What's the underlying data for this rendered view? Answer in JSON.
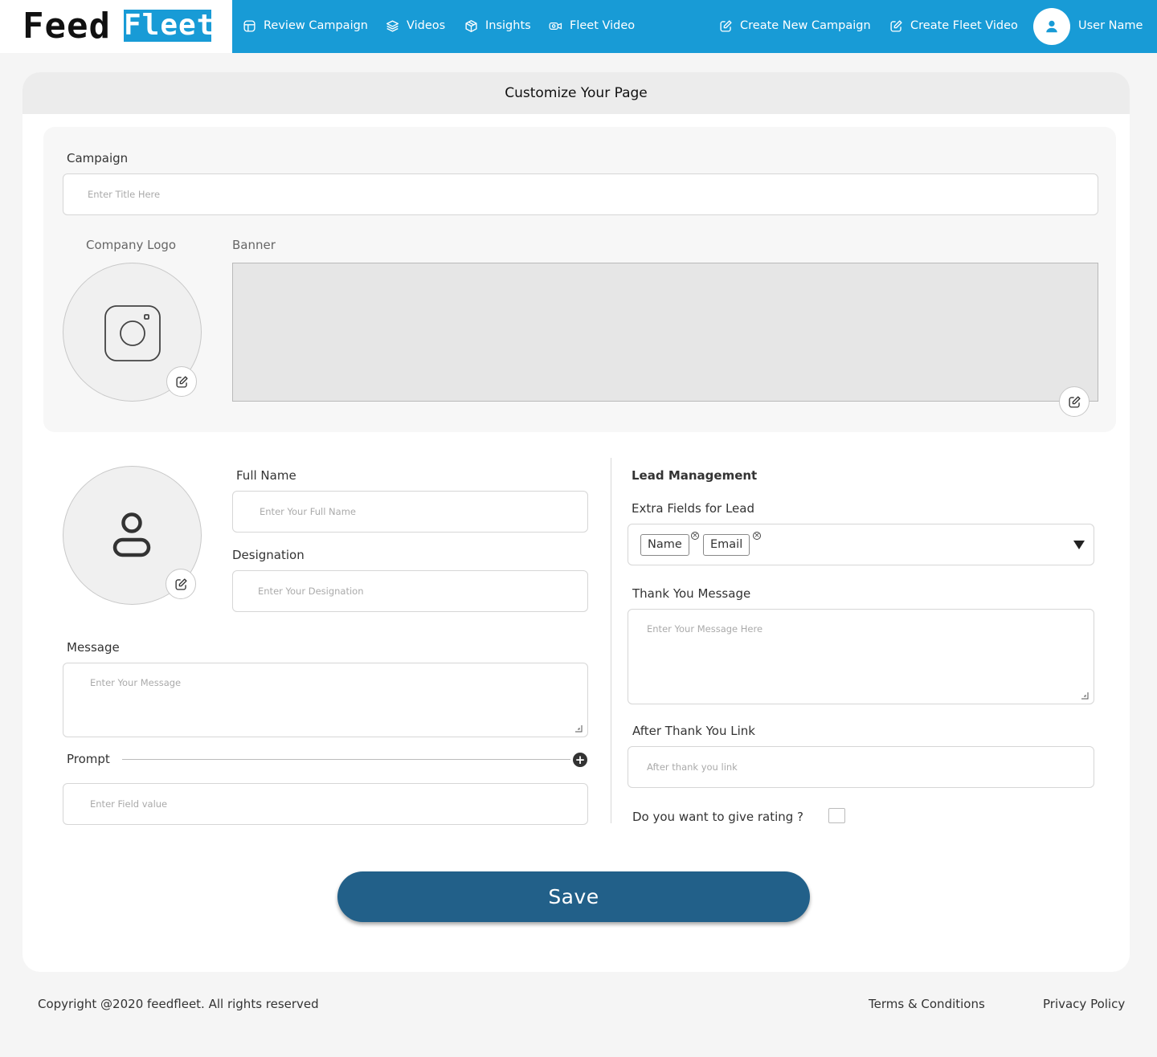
{
  "header": {
    "logo": {
      "part1": "Feed",
      "part2": "Fleet"
    },
    "nav": [
      {
        "label": "Review Campaign",
        "icon": "layout-icon"
      },
      {
        "label": "Videos",
        "icon": "layers-icon"
      },
      {
        "label": "Insights",
        "icon": "box-icon"
      },
      {
        "label": "Fleet Video",
        "icon": "video-camera-icon"
      }
    ],
    "actions": [
      {
        "label": "Create New Campaign",
        "icon": "edit-icon"
      },
      {
        "label": "Create Fleet Video",
        "icon": "edit-icon"
      }
    ],
    "user_name": "User Name",
    "accent_color": "#189bd6"
  },
  "page": {
    "title": "Customize Your Page",
    "campaign": {
      "label": "Campaign",
      "placeholder": "Enter Title Here"
    },
    "company_logo_label": "Company Logo",
    "banner_label": "Banner",
    "full_name": {
      "label": "Full Name",
      "placeholder": "Enter Your Full Name"
    },
    "designation": {
      "label": "Designation",
      "placeholder": "Enter Your Designation"
    },
    "message": {
      "label": "Message",
      "placeholder": "Enter Your Message"
    },
    "prompt": {
      "label": "Prompt",
      "placeholder": "Enter Field value",
      "add_symbol": "+"
    },
    "lead": {
      "heading": "Lead Management",
      "extra_fields_label": "Extra Fields for Lead",
      "extra_fields": [
        "Name",
        "Email"
      ],
      "remove_symbol": "×",
      "thank_you": {
        "label": "Thank You Message",
        "placeholder": "Enter Your Message Here"
      },
      "after_link": {
        "label": "After Thank You Link",
        "placeholder": "After thank you link"
      },
      "rating_label": "Do you want to give rating ?"
    },
    "save_label": "Save",
    "save_color": "#226089"
  },
  "footer": {
    "copyright": "Copyright @2020 feedfleet. All rights reserved",
    "terms": "Terms & Conditions",
    "privacy": "Privacy Policy"
  }
}
